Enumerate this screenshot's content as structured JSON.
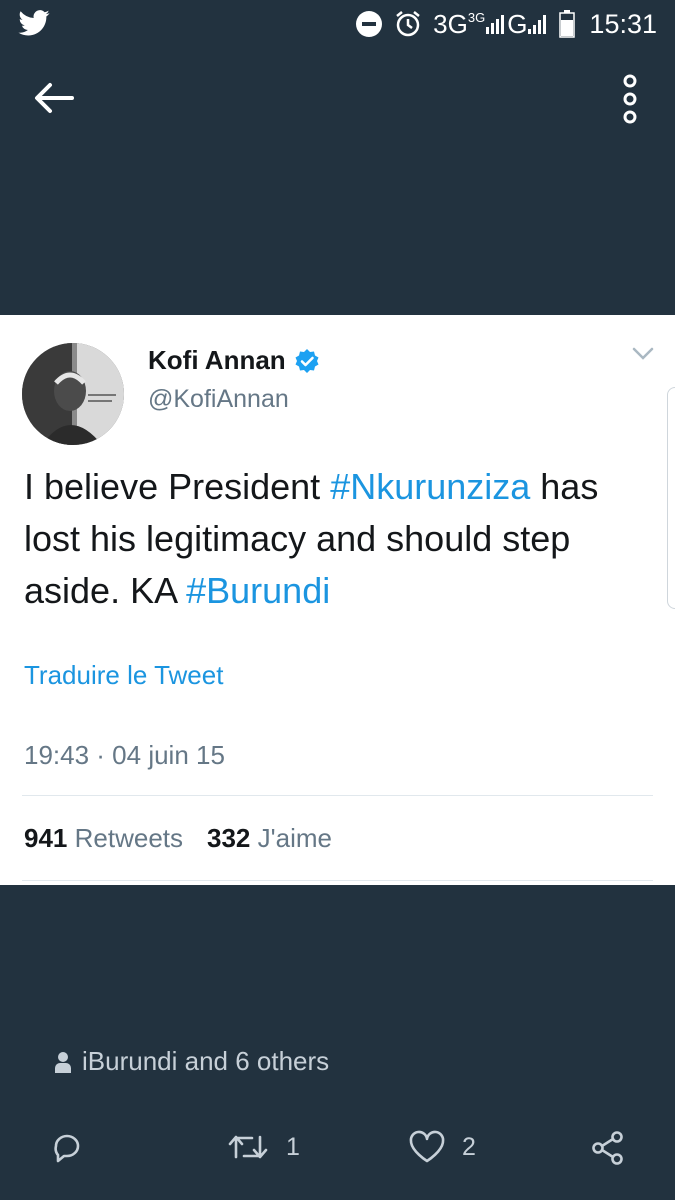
{
  "status_bar": {
    "network_primary": "3G",
    "network_secondary_sup": "3G",
    "network_tertiary": "G",
    "time": "15:31",
    "icons": [
      "twitter-bird-icon",
      "dnd-icon",
      "alarm-icon",
      "signal-icon",
      "battery-icon"
    ]
  },
  "app_bar": {
    "back_icon": "back-arrow-icon",
    "menu_icon": "overflow-menu-icon"
  },
  "tweet": {
    "author_name": "Kofi Annan",
    "author_handle": "@KofiAnnan",
    "verified": true,
    "text_part1": "I believe President ",
    "hashtag1": "#Nkurunziza",
    "text_part2": " has lost his legitimacy and should step aside. KA ",
    "hashtag2": "#Burundi",
    "translate_label": "Traduire le Tweet",
    "timestamp": "19:43 · 04 juin 15",
    "retweets_count": "941",
    "retweets_label": "Retweets",
    "likes_count": "332",
    "likes_label": "J'aime"
  },
  "footer": {
    "liked_by": "iBurundi and 6 others",
    "reply_icon": "reply-icon",
    "retweet_count": "1",
    "like_count": "2",
    "share_icon": "share-icon"
  },
  "colors": {
    "background": "#22323f",
    "card": "#ffffff",
    "link": "#1b95e0",
    "verified": "#1da1f2",
    "secondary_text": "#657786"
  }
}
